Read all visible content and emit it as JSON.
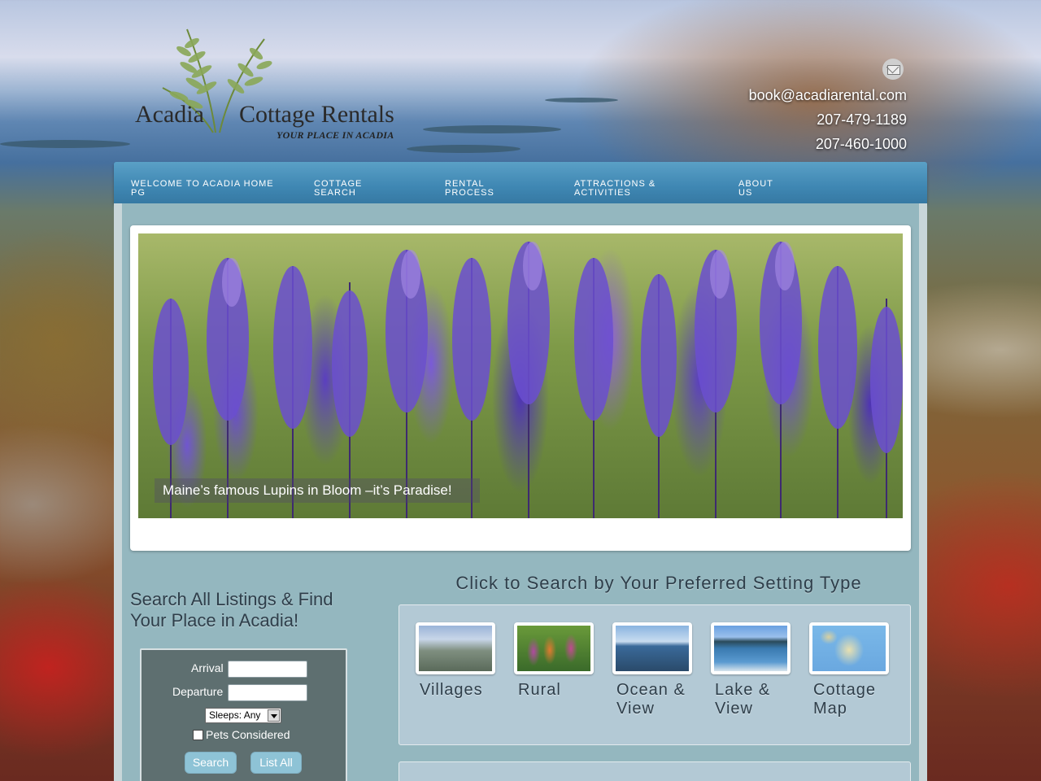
{
  "brand": {
    "name_left": "Acadia",
    "name_right": "Cottage Rentals",
    "tagline": "YOUR PLACE IN ACADIA"
  },
  "contact": {
    "email": "book@acadiarental.com",
    "phone1": "207-479-1189",
    "phone2": "207-460-1000",
    "icon": "mail-icon"
  },
  "nav": {
    "items": [
      {
        "line1": "WELCOME TO ACADIA HOME",
        "line2": "PG"
      },
      {
        "line1": "COTTAGE",
        "line2": "SEARCH"
      },
      {
        "line1": "RENTAL",
        "line2": "PROCESS"
      },
      {
        "line1": "ATTRACTIONS &",
        "line2": "ACTIVITIES"
      },
      {
        "line1": "ABOUT",
        "line2": "US"
      }
    ]
  },
  "slider": {
    "caption": "Maine’s famous Lupins in Bloom –it’s Paradise!"
  },
  "search": {
    "title": "Search All Listings & Find Your Place in Acadia!",
    "arrival_label": "Arrival",
    "departure_label": "Departure",
    "sleeps_value": "Sleeps: Any",
    "pets_label": "Pets Considered",
    "search_button": "Search",
    "list_all_button": "List All"
  },
  "settings": {
    "title": "Click to Search by Your Preferred Setting Type",
    "cards": [
      {
        "line1": "Villages",
        "line2": ""
      },
      {
        "line1": "Rural",
        "line2": ""
      },
      {
        "line1": "Ocean &",
        "line2": "View"
      },
      {
        "line1": "Lake &",
        "line2": "View"
      },
      {
        "line1": "Cottage",
        "line2": "Map"
      }
    ]
  },
  "colors": {
    "nav": "#3f87b3",
    "panel": "#94b7bf",
    "button": "#8ec3d6",
    "form_bg": "#5e6f70"
  }
}
